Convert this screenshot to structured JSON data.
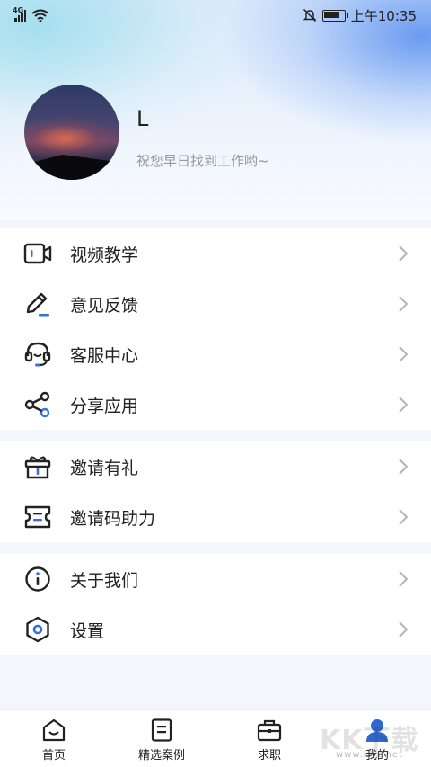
{
  "status_bar": {
    "network": "4G",
    "time": "上午10:35",
    "icons": [
      "signal-icon",
      "wifi-icon",
      "mute-icon",
      "battery-icon"
    ]
  },
  "profile": {
    "name": "L",
    "greeting": "祝您早日找到工作哟~"
  },
  "menu_groups": [
    {
      "items": [
        {
          "label": "视频教学",
          "icon": "video-icon"
        },
        {
          "label": "意见反馈",
          "icon": "pencil-icon"
        },
        {
          "label": "客服中心",
          "icon": "headset-icon"
        },
        {
          "label": "分享应用",
          "icon": "share-icon"
        }
      ]
    },
    {
      "items": [
        {
          "label": "邀请有礼",
          "icon": "gift-icon"
        },
        {
          "label": "邀请码助力",
          "icon": "ticket-icon"
        }
      ]
    },
    {
      "items": [
        {
          "label": "关于我们",
          "icon": "info-icon"
        },
        {
          "label": "设置",
          "icon": "settings-icon"
        }
      ]
    }
  ],
  "tab_bar": {
    "tabs": [
      {
        "label": "首页",
        "icon": "home-icon"
      },
      {
        "label": "精选案例",
        "icon": "document-icon"
      },
      {
        "label": "求职",
        "icon": "briefcase-icon"
      },
      {
        "label": "我的",
        "icon": "user-icon",
        "active": true
      }
    ]
  },
  "watermark": {
    "text": "KK下载",
    "url": "www.kkx.net"
  },
  "colors": {
    "accent": "#3b6fd8",
    "icon_stroke": "#222222",
    "muted_text": "#999999"
  }
}
